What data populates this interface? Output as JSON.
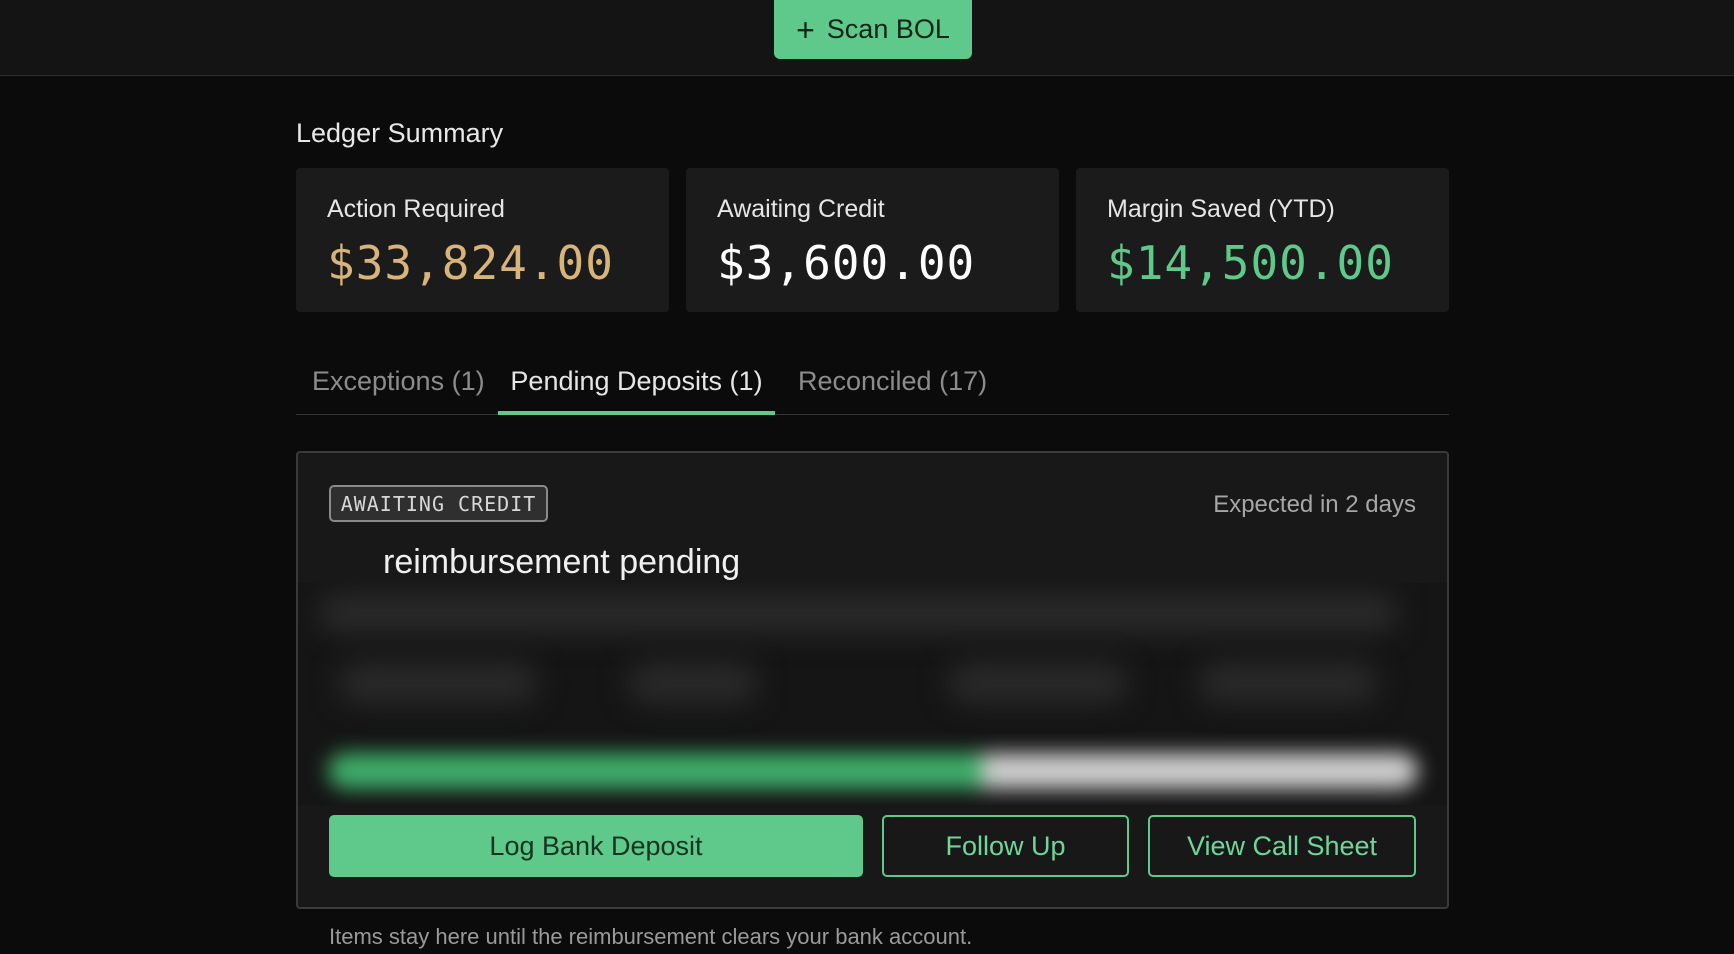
{
  "header": {
    "scan_label": "Scan BOL",
    "scan_icon": "plus-icon"
  },
  "summary": {
    "title": "Ledger Summary",
    "cards": [
      {
        "label": "Action Required",
        "value": "$33,824.00",
        "color": "#d8b47a"
      },
      {
        "label": "Awaiting Credit",
        "value": "$3,600.00",
        "color": "#ffffff"
      },
      {
        "label": "Margin Saved (YTD)",
        "value": "$14,500.00",
        "color": "#5ec98a"
      }
    ]
  },
  "tabs": [
    {
      "label": "Exceptions (1)",
      "active": false
    },
    {
      "label": "Pending Deposits (1)",
      "active": true
    },
    {
      "label": "Reconciled (17)",
      "active": false
    }
  ],
  "pending": {
    "badge": "AWAITING CREDIT",
    "expected": "Expected in 2 days",
    "heading": "reimbursement pending",
    "progress_fraction": 0.6,
    "actions": {
      "log_deposit": "Log Bank Deposit",
      "follow_up": "Follow Up",
      "view_call_sheet": "View Call Sheet"
    }
  },
  "footnote": "Items stay here until the reimbursement clears your bank account.",
  "colors": {
    "accent": "#5ec98a",
    "background": "#0b0b0b"
  }
}
